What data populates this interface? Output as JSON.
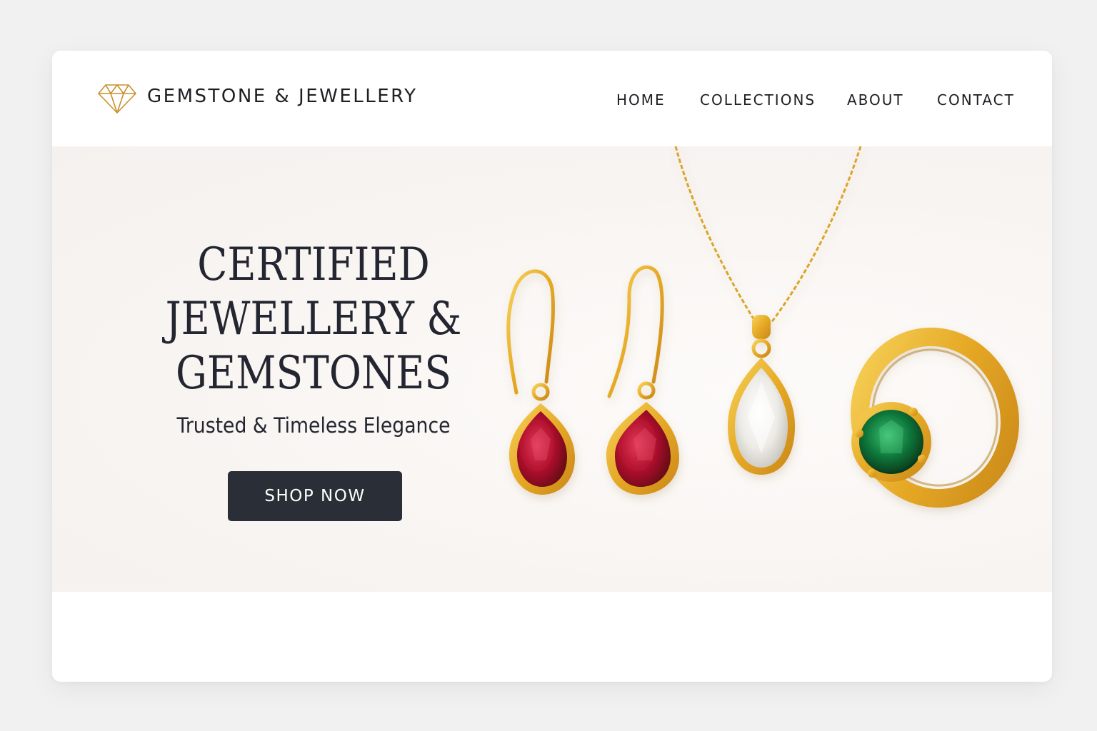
{
  "header": {
    "brand_name": "GEMSTONE & JEWELLERY",
    "logo_icon": "diamond-icon",
    "nav": [
      {
        "label": "HOME"
      },
      {
        "label": "COLLECTIONS"
      },
      {
        "label": "ABOUT"
      },
      {
        "label": "CONTACT"
      }
    ]
  },
  "hero": {
    "title_lines": [
      "CERTIFIED",
      "JEWELLERY &",
      "GEMSTONES"
    ],
    "subtitle": "Trusted & Timeless Elegance",
    "cta_label": "SHOP NOW",
    "products": [
      {
        "type": "earring",
        "stone": "ruby"
      },
      {
        "type": "earring",
        "stone": "ruby"
      },
      {
        "type": "pendant-necklace",
        "stone": "clear crystal"
      },
      {
        "type": "ring",
        "stone": "emerald"
      }
    ]
  },
  "colors": {
    "accent_gold": "#e2a526",
    "logo_gold": "#c98f2a",
    "button_bg": "#2a2f37",
    "text_dark": "#232630",
    "ruby": "#b3122f",
    "emerald": "#0f7a3c"
  }
}
